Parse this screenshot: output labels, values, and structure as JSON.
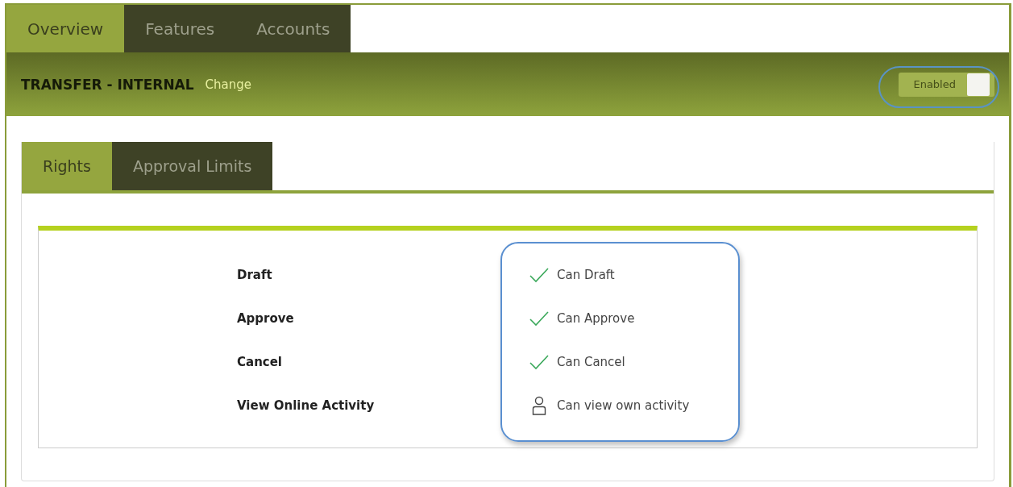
{
  "top_tabs": [
    {
      "label": "Overview",
      "selected": true
    },
    {
      "label": "Features",
      "selected": false
    },
    {
      "label": "Accounts",
      "selected": false
    }
  ],
  "header": {
    "title": "TRANSFER - INTERNAL",
    "change_link": "Change",
    "toggle": {
      "label": "Enabled",
      "on": true
    }
  },
  "sub_tabs": [
    {
      "label": "Rights",
      "selected": true
    },
    {
      "label": "Approval Limits",
      "selected": false
    }
  ],
  "rights": [
    {
      "name": "Draft",
      "kind": "check",
      "value": "Can Draft"
    },
    {
      "name": "Approve",
      "kind": "check",
      "value": "Can Approve"
    },
    {
      "name": "Cancel",
      "kind": "check",
      "value": "Can Cancel"
    },
    {
      "name": "View Online Activity",
      "kind": "person",
      "value": "Can view own activity"
    }
  ]
}
